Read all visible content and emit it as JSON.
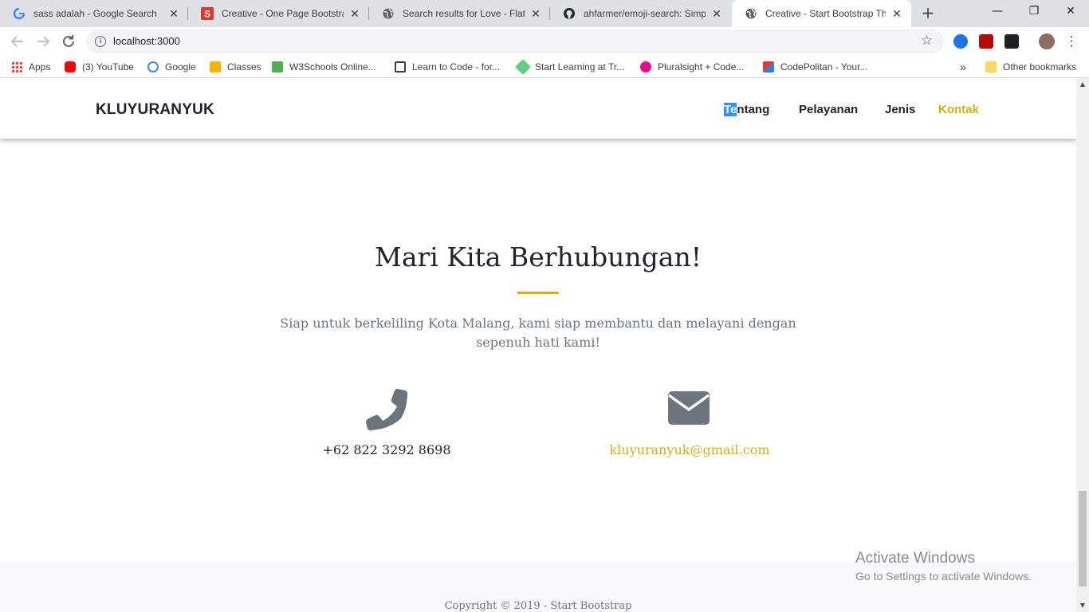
{
  "browser": {
    "tabs": [
      {
        "title": "sass adalah - Google Search",
        "icon": "google-icon"
      },
      {
        "title": "Creative - One Page Bootstrap",
        "icon": "s-logo-icon"
      },
      {
        "title": "Search results for Love - Flatico",
        "icon": "globe-icon"
      },
      {
        "title": "ahfarmer/emoji-search: Simple",
        "icon": "github-icon"
      },
      {
        "title": "Creative - Start Bootstrap Then",
        "icon": "globe-icon",
        "active": true
      }
    ],
    "new_tab": "+",
    "window_controls": {
      "minimize": "—",
      "maximize": "❐",
      "close": "✕"
    },
    "url": "localhost:3000",
    "bookmarks": [
      {
        "label": "Apps",
        "icon": "apps-grid-icon"
      },
      {
        "label": "(3) YouTube",
        "icon": "youtube-icon"
      },
      {
        "label": "Google",
        "icon": "google-icon"
      },
      {
        "label": "Classes",
        "icon": "classroom-icon"
      },
      {
        "label": "W3Schools Online...",
        "icon": "w3schools-icon"
      },
      {
        "label": "Learn to Code - for...",
        "icon": "freecodecamp-icon"
      },
      {
        "label": "Start Learning at Tr...",
        "icon": "treehouse-icon"
      },
      {
        "label": "Pluralsight + Code...",
        "icon": "pluralsight-icon"
      },
      {
        "label": "CodePolitan - Your...",
        "icon": "codepolitan-icon"
      }
    ],
    "more_bookmarks": "»",
    "other_bookmarks": "Other bookmarks"
  },
  "site": {
    "brand": "KLUYURANYUK",
    "nav": {
      "tentang_sel": "Te",
      "tentang_rest": "ntang",
      "pelayanan": "Pelayanan",
      "jenis": "Jenis",
      "kontak": "Kontak"
    },
    "contact": {
      "title": "Mari Kita Berhubungan!",
      "subtitle": "Siap untuk berkeliling Kota Malang, kami siap membantu dan melayani dengan sepenuh hati kami!",
      "phone": "+62 822 3292 8698",
      "email": "kluyuranyuk@gmail.com"
    },
    "footer": {
      "copyright": "Copyright © 2019 - Start Bootstrap"
    }
  },
  "os": {
    "watermark_title": "Activate Windows",
    "watermark_sub": "Go to Settings to activate Windows."
  },
  "colors": {
    "accent": "#d4b011",
    "selection": "#3390ff",
    "icon_gray": "#6c757d"
  }
}
